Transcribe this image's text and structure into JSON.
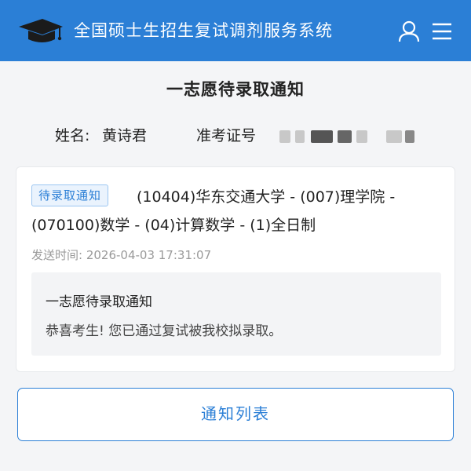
{
  "header": {
    "title": "全国硕士生招生复试调剂服务系统",
    "logo_icon": "graduation-cap-icon",
    "user_icon": "user-icon",
    "menu_icon": "menu-icon",
    "accent_color": "#2b7fd6"
  },
  "page": {
    "title": "一志愿待录取通知"
  },
  "candidate": {
    "name_label": "姓名:",
    "name_value": "黄诗君",
    "ticket_label": "准考证号"
  },
  "notice": {
    "tag": "待录取通知",
    "detail_line1": "(10404)华东交通大学 - (007)理学院 -",
    "detail_line2": "(070100)数学 - (04)计算数学 - (1)全日制",
    "sent_time": "发送时间: 2026-04-03 17:31:07",
    "message_title": "一志愿待录取通知",
    "message_body": "恭喜考生! 您已通过复试被我校拟录取。"
  },
  "footer": {
    "list_button": "通知列表"
  }
}
